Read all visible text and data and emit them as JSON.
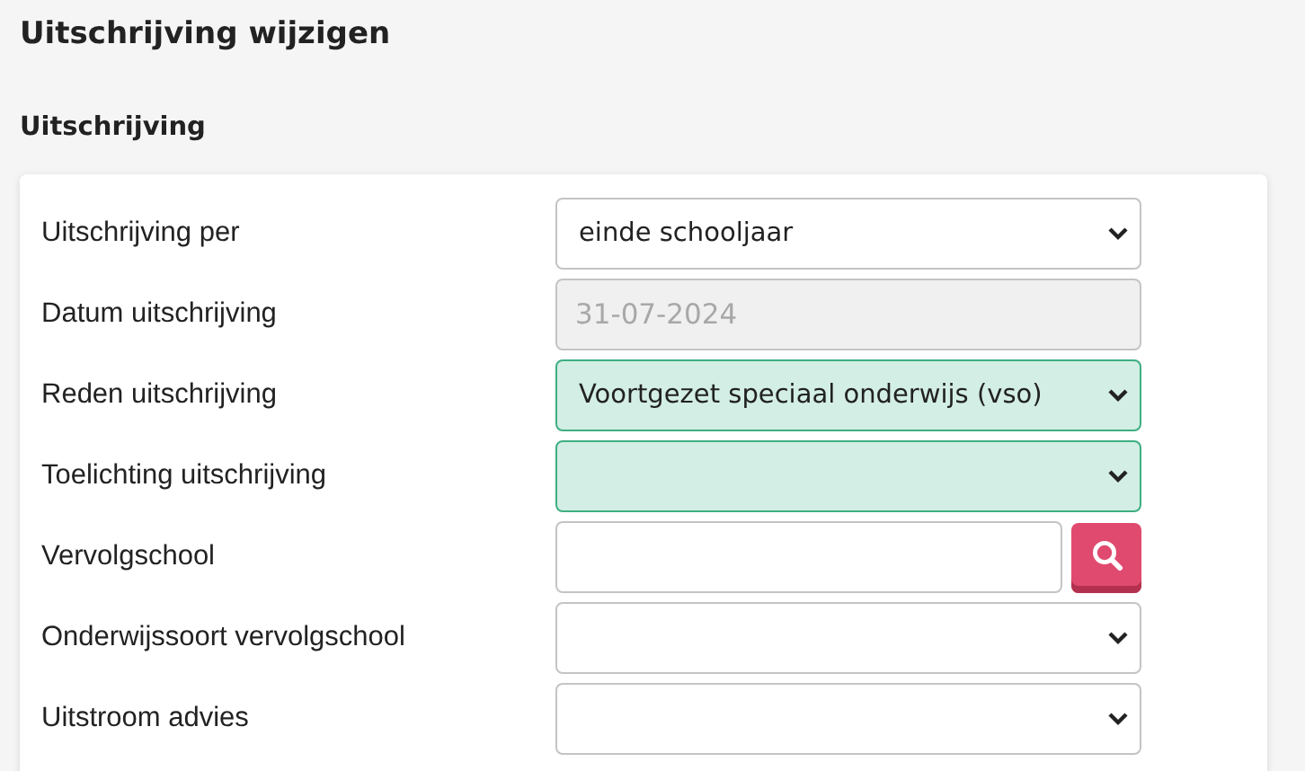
{
  "page": {
    "title": "Uitschrijving wijzigen"
  },
  "section": {
    "title": "Uitschrijving"
  },
  "fields": [
    {
      "label": "Uitschrijving per",
      "kind": "select",
      "value": "einde schooljaar",
      "highlighted": false,
      "disabled": false
    },
    {
      "label": "Datum uitschrijving",
      "kind": "text",
      "value": "31-07-2024",
      "highlighted": false,
      "disabled": true
    },
    {
      "label": "Reden uitschrijving",
      "kind": "select",
      "value": "Voortgezet speciaal onderwijs (vso)",
      "highlighted": true,
      "disabled": false
    },
    {
      "label": "Toelichting uitschrijving",
      "kind": "select",
      "highlighted": true,
      "disabled": false
    },
    {
      "label": "Vervolgschool",
      "kind": "search",
      "highlighted": false,
      "disabled": false
    },
    {
      "label": "Onderwijssoort vervolgschool",
      "kind": "select",
      "highlighted": false,
      "disabled": false
    },
    {
      "label": "Uitstroom advies",
      "kind": "select",
      "highlighted": false,
      "disabled": false
    }
  ]
}
